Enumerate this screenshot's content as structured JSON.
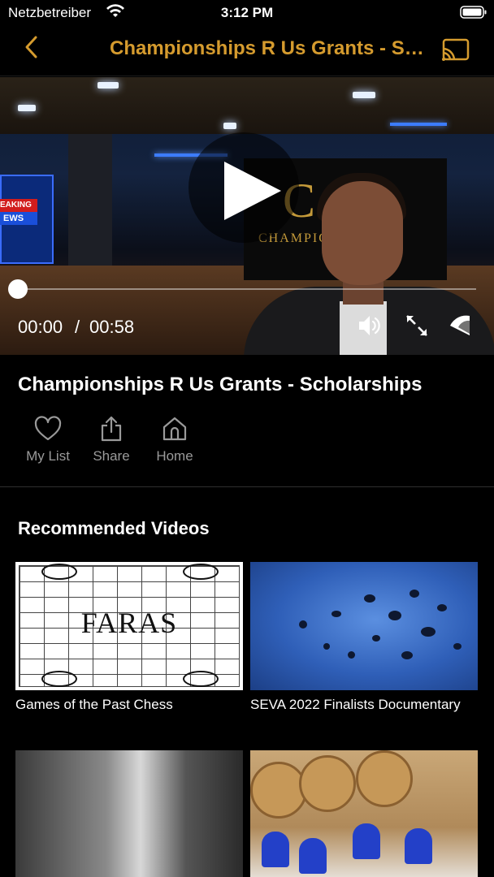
{
  "status_bar": {
    "carrier": "Netzbetreiber",
    "time": "3:12 PM"
  },
  "nav": {
    "title": "Championships R Us Grants - Scholarships",
    "back_icon": "chevron-left-icon",
    "cast_icon": "cast-icon",
    "accent_color": "#d59b2e"
  },
  "player": {
    "current_time": "00:00",
    "separator": "/",
    "total_time": "00:58",
    "progress": 0.0,
    "overlay_text_1": "EAKING",
    "overlay_text_2": "EWS",
    "brand_initial": "C",
    "brand_text": "CHAMPIO"
  },
  "video": {
    "title": "Championships R Us Grants - Scholarships",
    "actions": [
      {
        "label": "My List",
        "icon": "heart-icon"
      },
      {
        "label": "Share",
        "icon": "share-icon"
      },
      {
        "label": "Home",
        "icon": "home-icon"
      }
    ]
  },
  "recommended": {
    "title": "Recommended Videos",
    "items": [
      {
        "title": "Games of the Past Chess",
        "thumb_text": "FARAS"
      },
      {
        "title": "SEVA 2022 Finalists Documentary",
        "thumb_text": ""
      },
      {
        "title": "",
        "thumb_text": ""
      },
      {
        "title": "",
        "thumb_text": ""
      }
    ]
  }
}
